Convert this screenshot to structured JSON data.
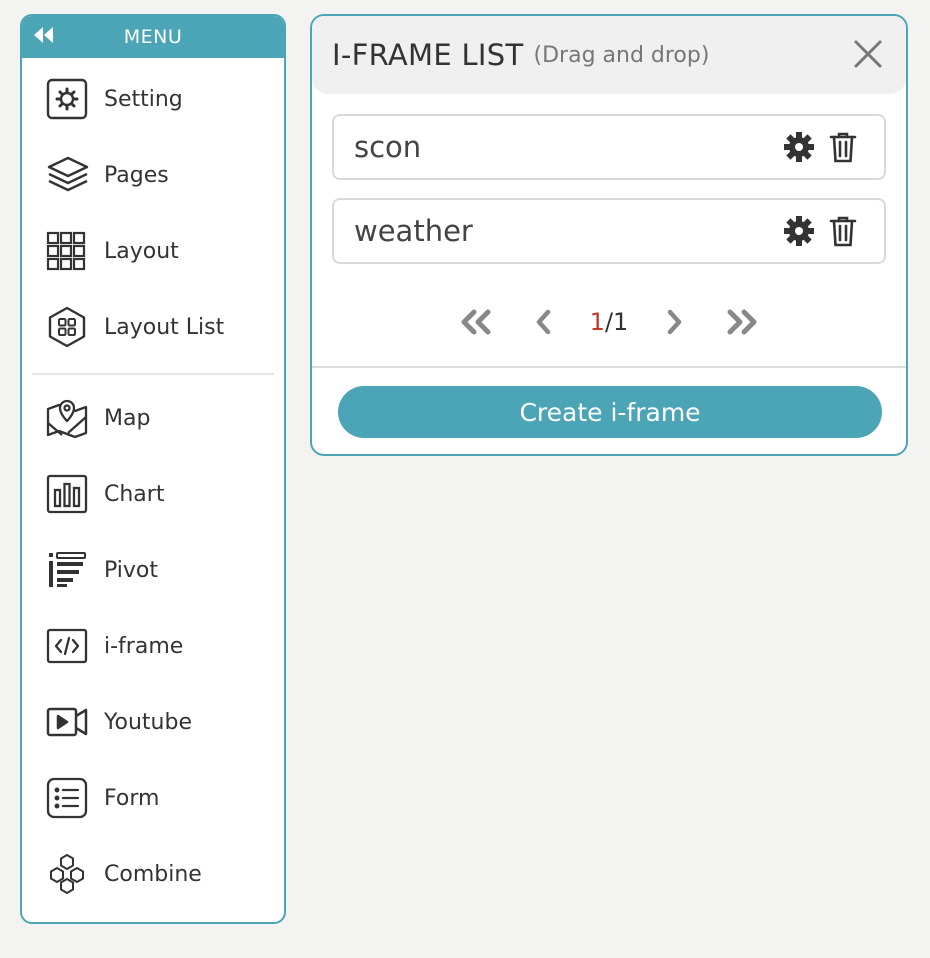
{
  "sidebar": {
    "title": "MENU",
    "group1": [
      {
        "label": "Setting",
        "icon": "gear-icon"
      },
      {
        "label": "Pages",
        "icon": "layers-icon"
      },
      {
        "label": "Layout",
        "icon": "grid-icon"
      },
      {
        "label": "Layout List",
        "icon": "hexagon-grid-icon"
      }
    ],
    "group2": [
      {
        "label": "Map",
        "icon": "map-icon"
      },
      {
        "label": "Chart",
        "icon": "bar-chart-icon"
      },
      {
        "label": "Pivot",
        "icon": "pivot-icon"
      },
      {
        "label": "i-frame",
        "icon": "code-icon"
      },
      {
        "label": "Youtube",
        "icon": "video-camera-icon"
      },
      {
        "label": "Form",
        "icon": "form-list-icon"
      },
      {
        "label": "Combine",
        "icon": "hexagons-icon"
      }
    ]
  },
  "panel": {
    "title": "I-FRAME LIST",
    "subtitle": "(Drag and drop)",
    "items": [
      {
        "name": "scon"
      },
      {
        "name": "weather"
      }
    ],
    "pagination": {
      "current": "1",
      "separator": "/",
      "total": "1"
    },
    "create_label": "Create i-frame"
  },
  "colors": {
    "accent": "#4ba5b6",
    "current_page": "#c0392b",
    "background": "#f3f3f1"
  }
}
